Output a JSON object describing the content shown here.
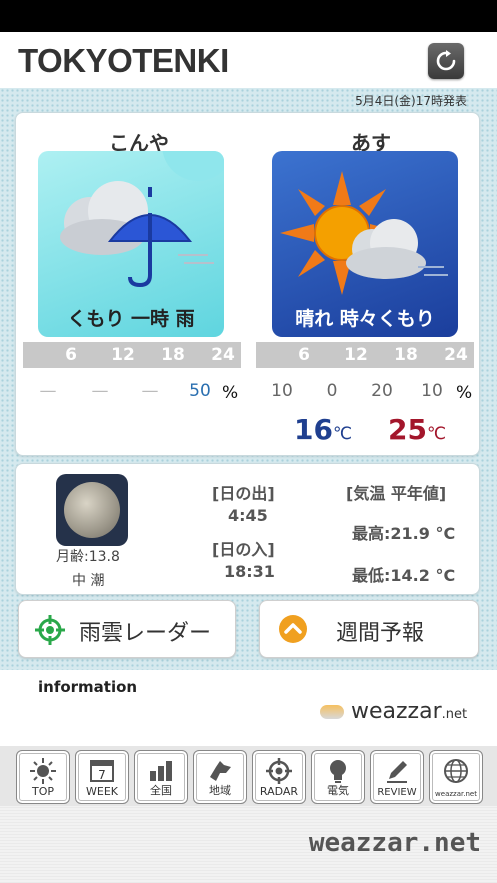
{
  "header": {
    "title": "TOKYOTENKI",
    "refresh_icon": "refresh-icon"
  },
  "issued": "5月4日(金)17時発表",
  "today": {
    "label": "こんや",
    "weather": "くもり 一時 雨",
    "hours": [
      "6",
      "12",
      "18",
      "24"
    ],
    "rain": [
      "—",
      "—",
      "—",
      "50"
    ],
    "pct": "%"
  },
  "tomorrow": {
    "label": "あす",
    "weather": "晴れ 時々くもり",
    "hours": [
      "6",
      "12",
      "18",
      "24"
    ],
    "rain": [
      "10",
      "0",
      "20",
      "10"
    ],
    "pct": "%",
    "min_temp": "16",
    "max_temp": "25",
    "temp_unit": "℃"
  },
  "sun": {
    "moon_age": "月齢:13.8",
    "tide": "中 潮",
    "sunrise_label": "[日の出]",
    "sunrise": "4:45",
    "sunset_label": "[日の入]",
    "sunset": "18:31",
    "normals_label": "[気温 平年値]",
    "normal_high": "最高:21.9 °C",
    "normal_low": "最低:14.2 °C"
  },
  "buttons": {
    "radar": "雨雲レーダー",
    "weekly": "週間予報"
  },
  "info": {
    "label": "information",
    "brand": "weazzar",
    "brand_suffix": ".net"
  },
  "tabs": [
    {
      "label": "TOP",
      "icon": "sun-icon"
    },
    {
      "label": "WEEK",
      "icon": "calendar-icon",
      "badge": "7"
    },
    {
      "label": "全国",
      "icon": "bar-chart-icon"
    },
    {
      "label": "地域",
      "icon": "hokkaido-map-icon"
    },
    {
      "label": "RADAR",
      "icon": "radar-icon"
    },
    {
      "label": "電気",
      "icon": "bulb-icon"
    },
    {
      "label": "REVIEW",
      "icon": "pencil-icon"
    },
    {
      "label": "weazzar.net",
      "icon": "globe-icon"
    }
  ],
  "footer": {
    "logo": "weazzar.net"
  },
  "colors": {
    "min_temp": "#1f3f8f",
    "max_temp": "#a3162b",
    "rain_pct": "#2a6fb0",
    "accent_green": "#2aa84a",
    "accent_orange": "#f0a020"
  }
}
